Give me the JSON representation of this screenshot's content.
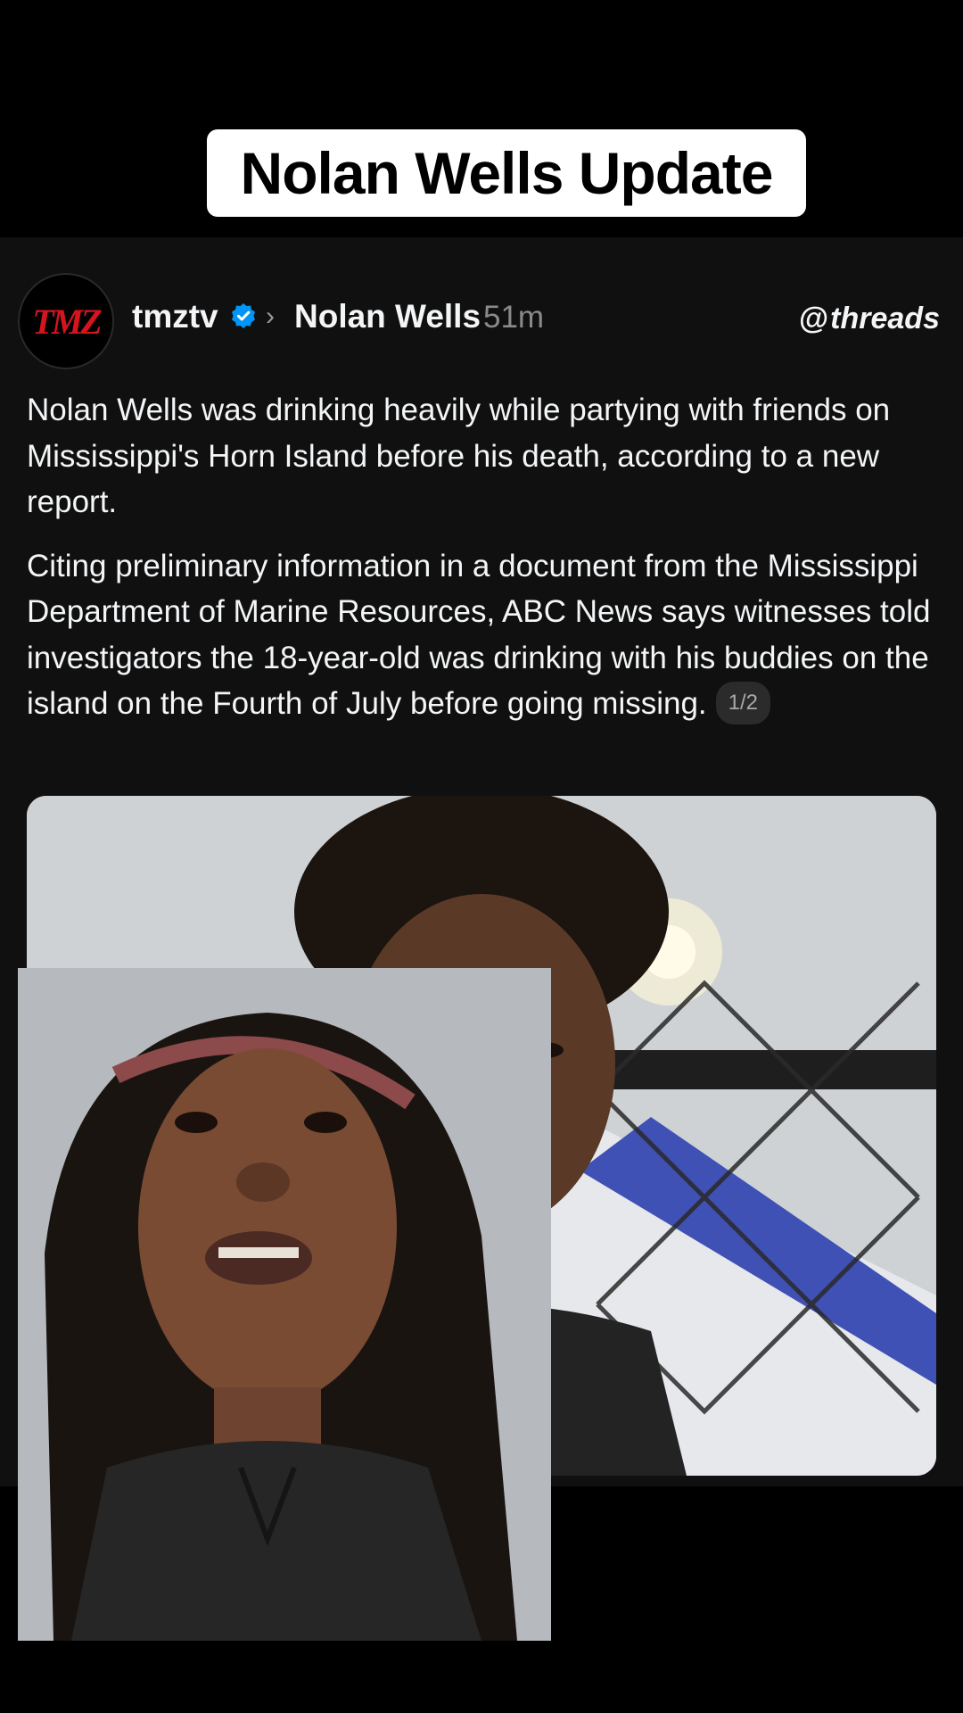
{
  "overlay": {
    "caption": "Nolan Wells Update"
  },
  "post": {
    "avatar_logo": "TMZ",
    "username": "tmztv",
    "topic": "Nolan Wells",
    "time_ago": "51m",
    "brand": "threads",
    "paragraph_1": "Nolan Wells was drinking heavily while partying with friends on Mississippi's Horn Island before his death, according to a new report.",
    "paragraph_2": "Citing preliminary information in a document from the Mississippi Department of Marine Resources, ABC News says witnesses told investigators the 18-year-old was drinking with his buddies on the island on the Fourth of July before going missing.",
    "pager": "1/2"
  },
  "colors": {
    "card_bg": "#101010",
    "text": "#f3f5f7",
    "muted": "#8a8a8a",
    "verified_blue": "#0095f6",
    "tmz_red": "#d6141d"
  }
}
